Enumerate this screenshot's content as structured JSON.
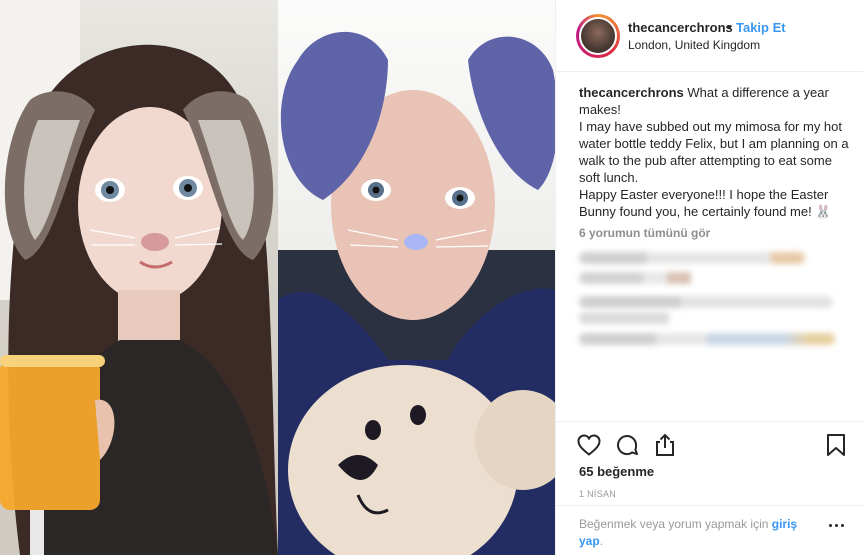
{
  "post": {
    "username": "thecancerchrons",
    "dot": "•",
    "follow_label": "Takip Et",
    "location": "London, United Kingdom",
    "caption_user": "thecancerchrons",
    "caption_lines": [
      "What a difference a year makes!",
      "I may have subbed out my mimosa for my hot water bottle teddy Felix, but I am planning on a walk to the pub after attempting to eat some soft lunch.",
      "Happy Easter everyone!!! I hope the Easter Bunny found you, he certainly found me! 🐰"
    ],
    "see_all_comments": "6 yorumun tümünü gör",
    "likes": "65 beğenme",
    "date": "1 NİSAN",
    "login_prompt": "Beğenmek veya yorum yapmak için",
    "login_link": "giriş yap",
    "login_suffix": "."
  },
  "icons": {
    "like": "heart-icon",
    "comment": "comment-icon",
    "share": "share-icon",
    "save": "bookmark-icon",
    "more": "more-icon"
  },
  "colors": {
    "link": "#3897f0",
    "text": "#262626",
    "muted": "#8e8e8e",
    "divider": "#efefef"
  }
}
